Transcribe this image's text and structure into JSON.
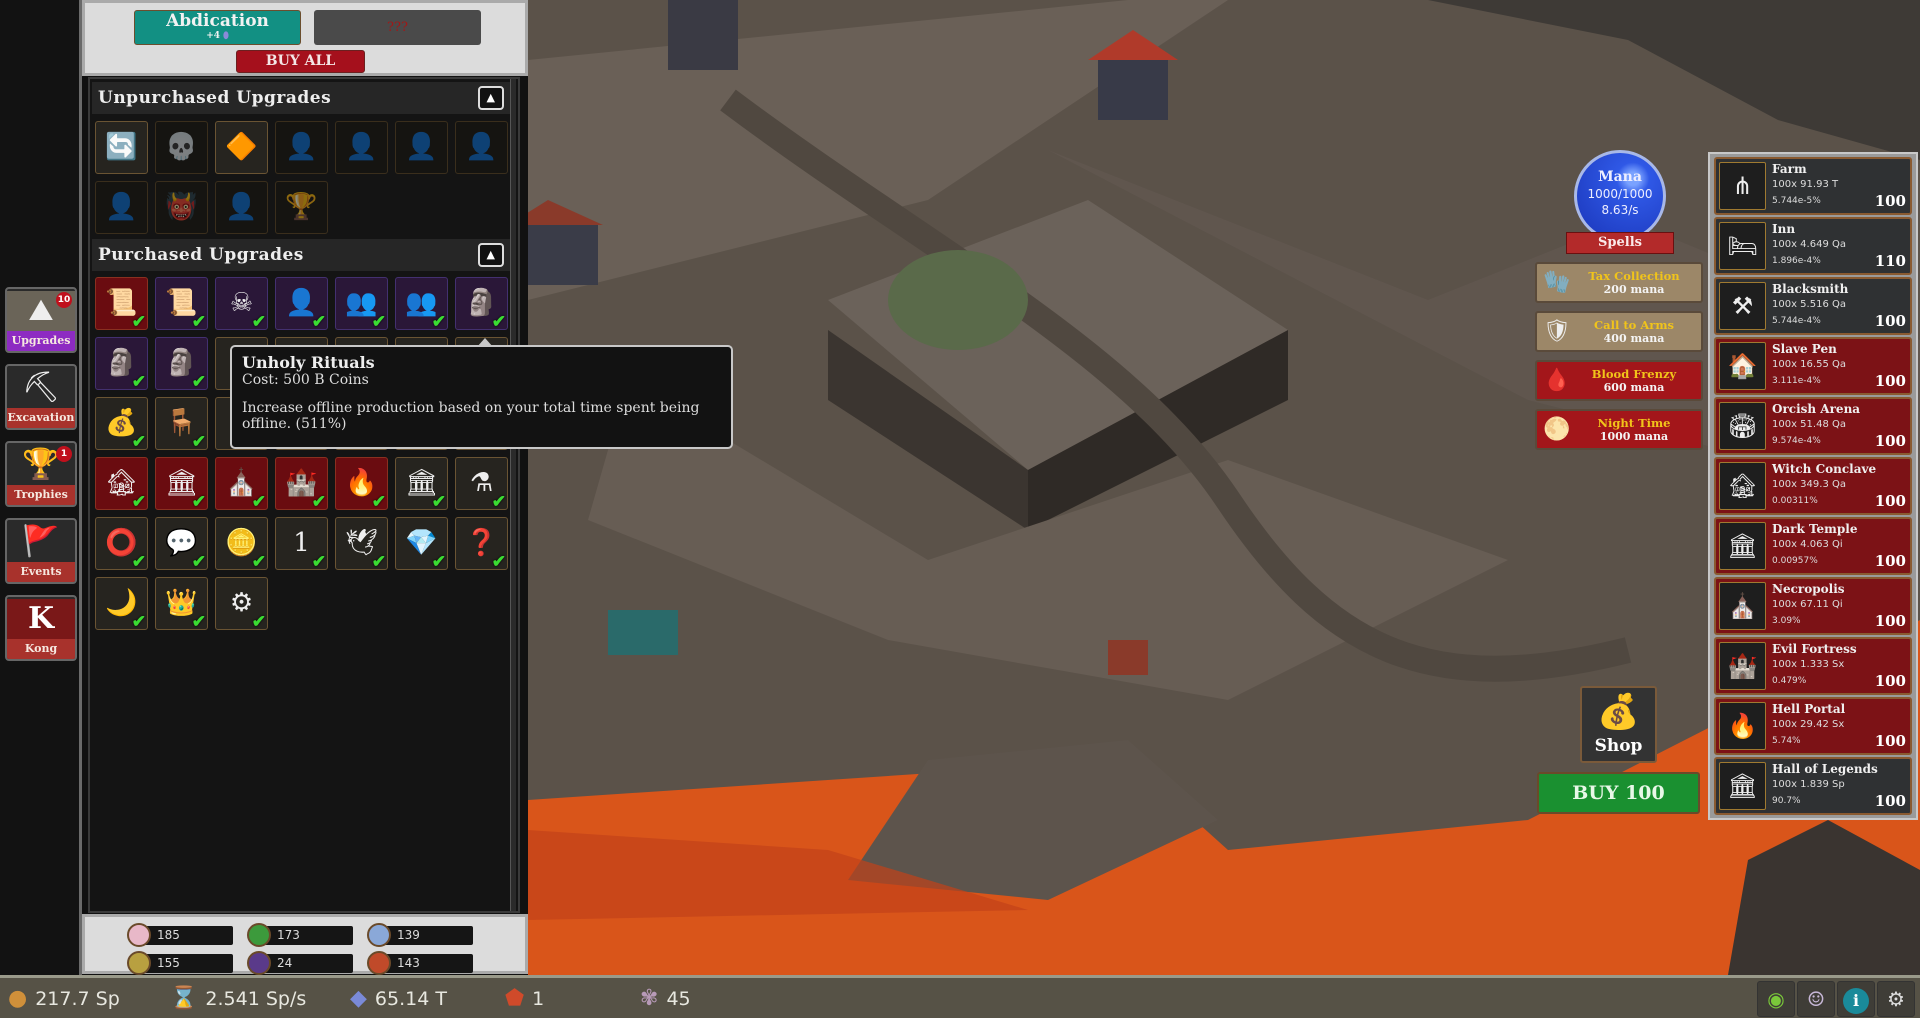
{
  "nav": [
    {
      "label": "Upgrades",
      "icon": "upgrade-arrow-icon",
      "badge": "10",
      "active": true
    },
    {
      "label": "Excavation",
      "icon": "shovel-icon",
      "badge": ""
    },
    {
      "label": "Trophies",
      "icon": "trophy-icon",
      "badge": "1"
    },
    {
      "label": "Events",
      "icon": "flag-icon",
      "badge": ""
    },
    {
      "label": "Kong",
      "icon": "kong-k-icon",
      "badge": ""
    }
  ],
  "top": {
    "abdication_label": "Abdication",
    "abdication_reward": "+4",
    "unknown_label": "???",
    "buy_all_label": "BUY ALL"
  },
  "unpurchased": {
    "title": "Unpurchased Upgrades",
    "items": [
      {
        "icon": "coin-exchange-icon",
        "glyph": "🔄",
        "bg": "dark"
      },
      {
        "icon": "skull-shield-icon",
        "glyph": "💀",
        "bg": "dark",
        "locked": true
      },
      {
        "icon": "orange-gem-icon",
        "glyph": "🔶",
        "bg": "dark"
      },
      {
        "icon": "faction-bust-icon",
        "glyph": "👤",
        "bg": "dark",
        "locked": true
      },
      {
        "icon": "faction-bust-icon",
        "glyph": "👤",
        "bg": "dark",
        "locked": true
      },
      {
        "icon": "faction-bust-icon",
        "glyph": "👤",
        "bg": "dark",
        "locked": true
      },
      {
        "icon": "faction-bust-icon",
        "glyph": "👤",
        "bg": "dark",
        "locked": true
      },
      {
        "icon": "faction-bust-icon",
        "glyph": "👤",
        "bg": "dark",
        "locked": true
      },
      {
        "icon": "demon-bust-icon",
        "glyph": "👹",
        "bg": "dark",
        "locked": true
      },
      {
        "icon": "faction-bust-icon",
        "glyph": "👤",
        "bg": "dark",
        "locked": true
      },
      {
        "icon": "trophy-icon",
        "glyph": "🏆",
        "bg": "dark",
        "locked": true
      }
    ]
  },
  "purchased": {
    "title": "Purchased Upgrades",
    "items": [
      {
        "icon": "decree-scroll-icon",
        "glyph": "📜",
        "bg": "red"
      },
      {
        "icon": "scroll-icon",
        "glyph": "📜",
        "bg": "purple"
      },
      {
        "icon": "skull-crossed-icon",
        "glyph": "☠",
        "bg": "purple"
      },
      {
        "icon": "bust-icon",
        "glyph": "👤",
        "bg": "purple"
      },
      {
        "icon": "busts-icon",
        "glyph": "👥",
        "bg": "purple"
      },
      {
        "icon": "busts-icon",
        "glyph": "👥",
        "bg": "purple"
      },
      {
        "icon": "stone-bust-icon",
        "glyph": "🗿",
        "bg": "purple"
      },
      {
        "icon": "stone-busts-icon",
        "glyph": "🗿",
        "bg": "purple"
      },
      {
        "icon": "stone-busts-icon",
        "glyph": "🗿",
        "bg": "purple"
      },
      {
        "icon": "upgrade-icon",
        "glyph": "",
        "bg": "dark"
      },
      {
        "icon": "upgrade-icon",
        "glyph": "",
        "bg": "dark"
      },
      {
        "icon": "upgrade-icon",
        "glyph": "",
        "bg": "dark"
      },
      {
        "icon": "upgrade-icon",
        "glyph": "",
        "bg": "dark"
      },
      {
        "icon": "upgrade-icon",
        "glyph": "",
        "bg": "dark"
      },
      {
        "icon": "treasure-chest-icon",
        "glyph": "💰",
        "bg": "dark"
      },
      {
        "icon": "throne-icon",
        "glyph": "🪑",
        "bg": "dark"
      },
      {
        "icon": "upgrade-icon",
        "glyph": "",
        "bg": "dark"
      },
      {
        "icon": "upgrade-icon",
        "glyph": "",
        "bg": "dark"
      },
      {
        "icon": "upgrade-icon",
        "glyph": "",
        "bg": "dark"
      },
      {
        "icon": "upgrade-icon",
        "glyph": "",
        "bg": "dark"
      },
      {
        "icon": "upgrade-icon",
        "glyph": "",
        "bg": "dark"
      },
      {
        "icon": "witch-conclave-icon",
        "glyph": "🏚",
        "bg": "red"
      },
      {
        "icon": "dark-temple-icon",
        "glyph": "🏛",
        "bg": "red"
      },
      {
        "icon": "necropolis-icon",
        "glyph": "⛪",
        "bg": "red"
      },
      {
        "icon": "evil-fortress-icon",
        "glyph": "🏰",
        "bg": "red"
      },
      {
        "icon": "hell-portal-icon",
        "glyph": "🔥",
        "bg": "red"
      },
      {
        "icon": "hall-of-legends-icon",
        "glyph": "🏛",
        "bg": "dark"
      },
      {
        "icon": "potion-icon",
        "glyph": "⚗",
        "bg": "dark"
      },
      {
        "icon": "purple-ring-icon",
        "glyph": "⭕",
        "bg": "dark"
      },
      {
        "icon": "strike-icon",
        "glyph": "💬",
        "bg": "dark"
      },
      {
        "icon": "coins-icon",
        "glyph": "🪙",
        "bg": "dark"
      },
      {
        "icon": "number-one-icon",
        "glyph": "1",
        "bg": "dark"
      },
      {
        "icon": "dove-icon",
        "glyph": "🕊",
        "bg": "dark"
      },
      {
        "icon": "crystal-beast-icon",
        "glyph": "💎",
        "bg": "dark"
      },
      {
        "icon": "thinking-figure-icon",
        "glyph": "❓",
        "bg": "dark"
      },
      {
        "icon": "moon-icon",
        "glyph": "🌙",
        "bg": "dark"
      },
      {
        "icon": "crowned-figure-icon",
        "glyph": "👑",
        "bg": "dark"
      },
      {
        "icon": "grindstone-icon",
        "glyph": "⚙",
        "bg": "dark"
      }
    ]
  },
  "tooltip": {
    "title": "Unholy Rituals",
    "cost": "Cost: 500 B Coins",
    "description": "Increase offline production based on your total time spent being offline. (511%)"
  },
  "faction_resources": [
    {
      "icon": "fairy-icon",
      "color": "#e8b8c8",
      "value": "185"
    },
    {
      "icon": "elf-icon",
      "color": "#3c9a3c",
      "value": "173"
    },
    {
      "icon": "angel-icon",
      "color": "#8aa8d8",
      "value": "139"
    },
    {
      "icon": "dwarf-icon",
      "color": "#b8a040",
      "value": "155"
    },
    {
      "icon": "undead-icon",
      "color": "#5a3a8a",
      "value": "24"
    },
    {
      "icon": "demon-icon",
      "color": "#c04a2a",
      "value": "143"
    }
  ],
  "bottom": {
    "coins": "217.7 Sp",
    "rate": "2.541 Sp/s",
    "gems": "65.14 T",
    "rubies": "1",
    "reincarnation": "45"
  },
  "mana": {
    "title": "Mana",
    "amount": "1000/1000",
    "regen": "8.63/s",
    "current": 1000,
    "max": 1000
  },
  "spells": {
    "banner": "Spells",
    "items": [
      {
        "name": "Tax Collection",
        "cost": "200 mana",
        "style": "tan",
        "icon": "glove-icon",
        "glyph": "🧤"
      },
      {
        "name": "Call to Arms",
        "cost": "400 mana",
        "style": "tan",
        "icon": "shield-sword-icon",
        "glyph": "🛡"
      },
      {
        "name": "Blood Frenzy",
        "cost": "600 mana",
        "style": "red",
        "icon": "blood-icon",
        "glyph": "🩸"
      },
      {
        "name": "Night Time",
        "cost": "1000 mana",
        "style": "red",
        "icon": "moon-cloud-icon",
        "glyph": "🌕"
      }
    ]
  },
  "shop_label": "Shop",
  "buy_amount_label": "BUY 100",
  "buildings": [
    {
      "name": "Farm",
      "cost": "100x 91.93 T",
      "pct": "5.744e-5%",
      "owned": "100",
      "style": "gray",
      "glyph": "⋔"
    },
    {
      "name": "Inn",
      "cost": "100x 4.649 Qa",
      "pct": "1.896e-4%",
      "owned": "110",
      "style": "gray",
      "glyph": "🛏"
    },
    {
      "name": "Blacksmith",
      "cost": "100x 5.516 Qa",
      "pct": "5.744e-4%",
      "owned": "100",
      "style": "gray",
      "glyph": "⚒"
    },
    {
      "name": "Slave Pen",
      "cost": "100x 16.55 Qa",
      "pct": "3.111e-4%",
      "owned": "100",
      "style": "red",
      "glyph": "🏠"
    },
    {
      "name": "Orcish Arena",
      "cost": "100x 51.48 Qa",
      "pct": "9.574e-4%",
      "owned": "100",
      "style": "red",
      "glyph": "🏟"
    },
    {
      "name": "Witch Conclave",
      "cost": "100x 349.3 Qa",
      "pct": "0.00311%",
      "owned": "100",
      "style": "red",
      "glyph": "🏚"
    },
    {
      "name": "Dark Temple",
      "cost": "100x 4.063 Qi",
      "pct": "0.00957%",
      "owned": "100",
      "style": "red",
      "glyph": "🏛"
    },
    {
      "name": "Necropolis",
      "cost": "100x 67.11 Qi",
      "pct": "3.09%",
      "owned": "100",
      "style": "red",
      "glyph": "⛪"
    },
    {
      "name": "Evil Fortress",
      "cost": "100x 1.333 Sx",
      "pct": "0.479%",
      "owned": "100",
      "style": "red",
      "glyph": "🏰"
    },
    {
      "name": "Hell Portal",
      "cost": "100x 29.42 Sx",
      "pct": "5.74%",
      "owned": "100",
      "style": "red",
      "glyph": "🔥"
    },
    {
      "name": "Hall of Legends",
      "cost": "100x 1.839 Sp",
      "pct": "90.7%",
      "owned": "100",
      "style": "gray",
      "glyph": "🏛"
    }
  ],
  "colors": {
    "gray_building": "#2f3133",
    "red_building": "#7c1216",
    "buy_green": "#1a9030",
    "abdication_teal": "#129083",
    "buy_all_red": "#a5101c"
  }
}
